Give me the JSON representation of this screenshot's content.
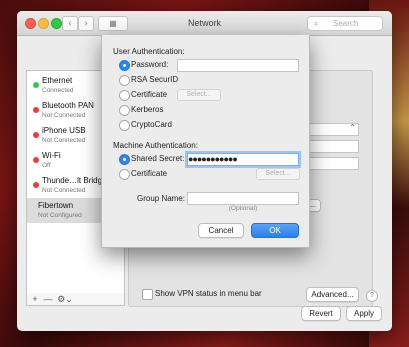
{
  "window": {
    "title": "Network",
    "search_placeholder": "Search"
  },
  "services": [
    {
      "name": "Ethernet",
      "status": "Connected",
      "dot_color": "#34c84a"
    },
    {
      "name": "Bluetooth PAN",
      "status": "Not Connected",
      "dot_color": "#e5413a"
    },
    {
      "name": "iPhone USB",
      "status": "Not Connected",
      "dot_color": "#e5413a"
    },
    {
      "name": "Wi-Fi",
      "status": "Off",
      "dot_color": "#e5413a"
    },
    {
      "name": "Thunde…lt Bridge",
      "status": "Not Connected",
      "dot_color": "#e5413a"
    },
    {
      "name": "Fibertown",
      "status": "Not Configured",
      "dot_color": "",
      "selected": true
    }
  ],
  "sidebar_controls": {
    "add": "+",
    "remove": "—",
    "gear": "⚙︎⌄"
  },
  "panel": {
    "show_vpn_status_label": "Show VPN status in menu bar",
    "advanced_button": "Advanced...",
    "help": "?",
    "partial_button": "..."
  },
  "footer": {
    "revert": "Revert",
    "apply": "Apply"
  },
  "sheet": {
    "user_auth_heading": "User Authentication:",
    "user_options": [
      "Password:",
      "RSA SecurID",
      "Certificate",
      "Kerberos",
      "CryptoCard"
    ],
    "user_selected": "Password:",
    "password_value": "",
    "select_button": "Select...",
    "machine_auth_heading": "Machine Authentication:",
    "machine_options": [
      "Shared Secret:",
      "Certificate"
    ],
    "machine_selected": "Shared Secret:",
    "shared_secret_value": "●●●●●●●●●●●",
    "machine_select_button": "Select...",
    "group_name_label": "Group Name:",
    "group_name_value": "",
    "group_name_hint": "(Optional)",
    "cancel": "Cancel",
    "ok": "OK"
  },
  "colors": {
    "accent": "#2d86ee",
    "connected": "#34c84a",
    "disconnected": "#e5413a"
  }
}
